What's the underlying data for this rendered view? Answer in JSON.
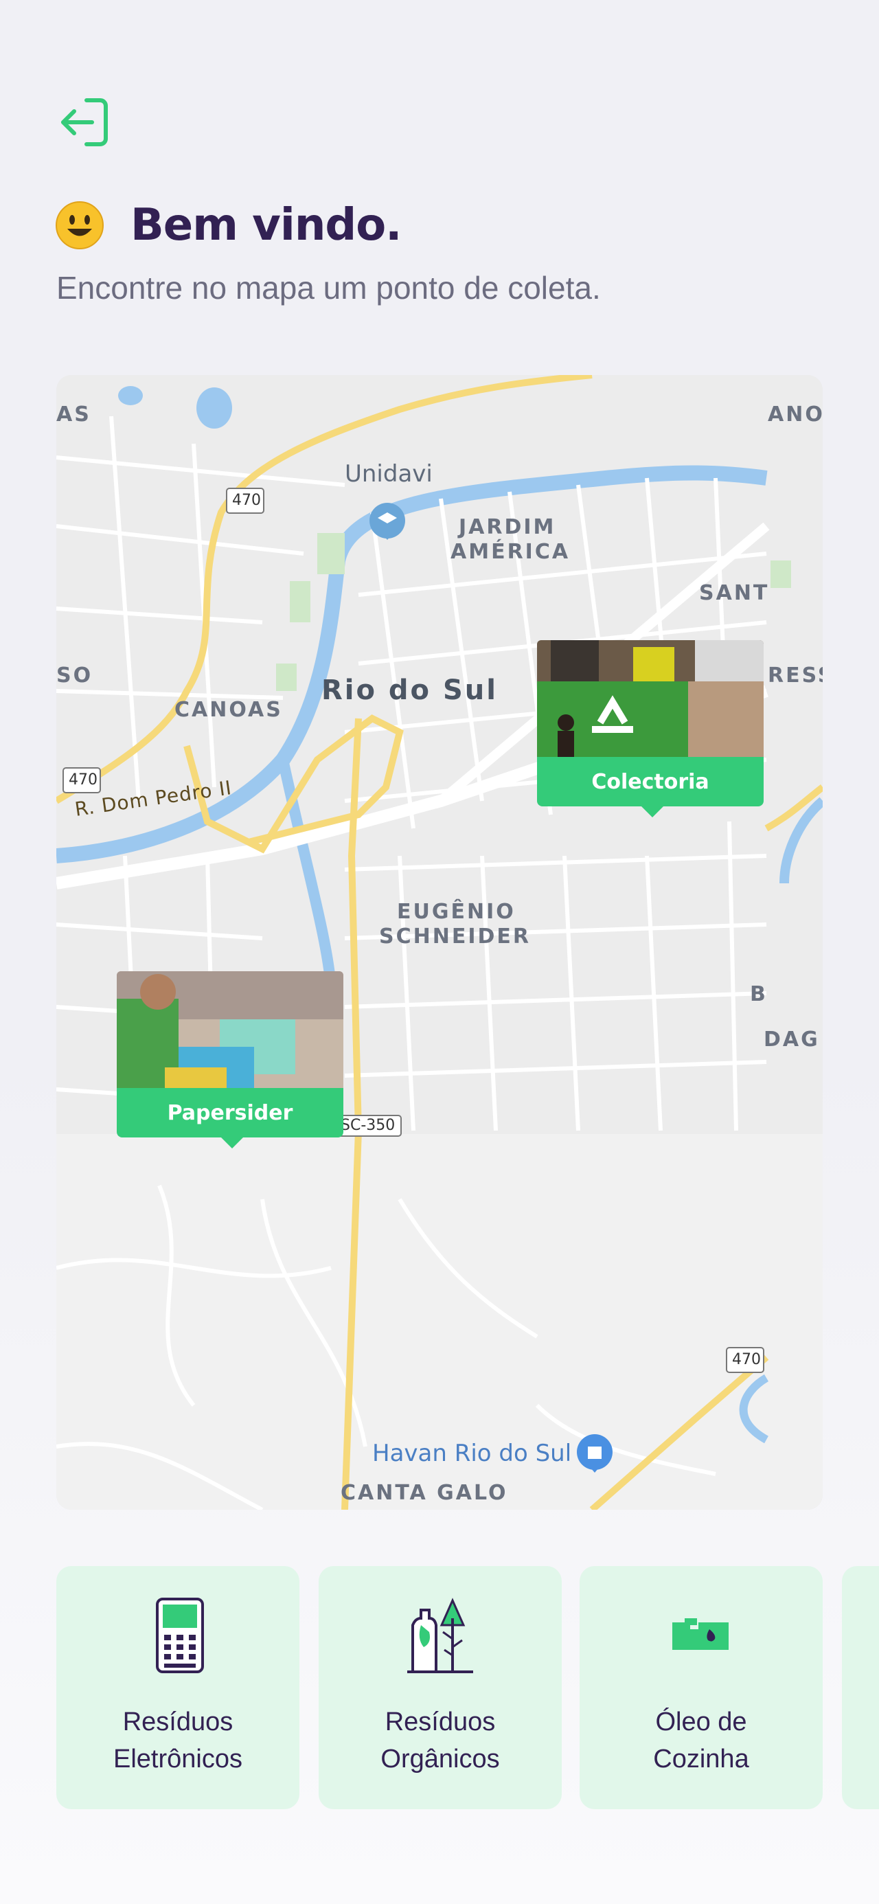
{
  "header": {
    "title": "Bem vindo.",
    "subtitle": "Encontre no mapa um ponto de coleta."
  },
  "icons": {
    "logout": "log-out-icon",
    "emoji": "smiling-face-emoji"
  },
  "colors": {
    "accent": "#34cb79",
    "title": "#322153",
    "text": "#6c6c80",
    "card_bg": "#e1f7ea"
  },
  "map": {
    "labels": {
      "unidavi": "Unidavi",
      "jardim": "JARDIM",
      "america": "AMÉRICA",
      "rio_do_sul": "Rio do Sul",
      "canoas": "CANOAS",
      "rua": "R. Dom Pedro II",
      "eugenio": "EUGÊNIO",
      "schneider": "SCHNEIDER",
      "havan": "Havan Rio do Sul",
      "canta_galo": "CANTA GALO",
      "santa": "SANT",
      "ress": "RESS",
      "as": "AS",
      "so": "SO",
      "anoa": "ANOA",
      "b": "B",
      "dag": "DAG",
      "sc350": "SC-350",
      "r470a": "470",
      "r470b": "470",
      "r470c": "470"
    },
    "points": [
      {
        "name": "Colectoria"
      },
      {
        "name": "Papersider"
      }
    ]
  },
  "items": [
    {
      "label_line1": "Resíduos",
      "label_line2": "Eletrônicos",
      "icon": "battery-electronic-icon"
    },
    {
      "label_line1": "Resíduos",
      "label_line2": "Orgânicos",
      "icon": "organic-waste-icon"
    },
    {
      "label_line1": "Óleo de",
      "label_line2": "Cozinha",
      "icon": "cooking-oil-icon"
    }
  ]
}
